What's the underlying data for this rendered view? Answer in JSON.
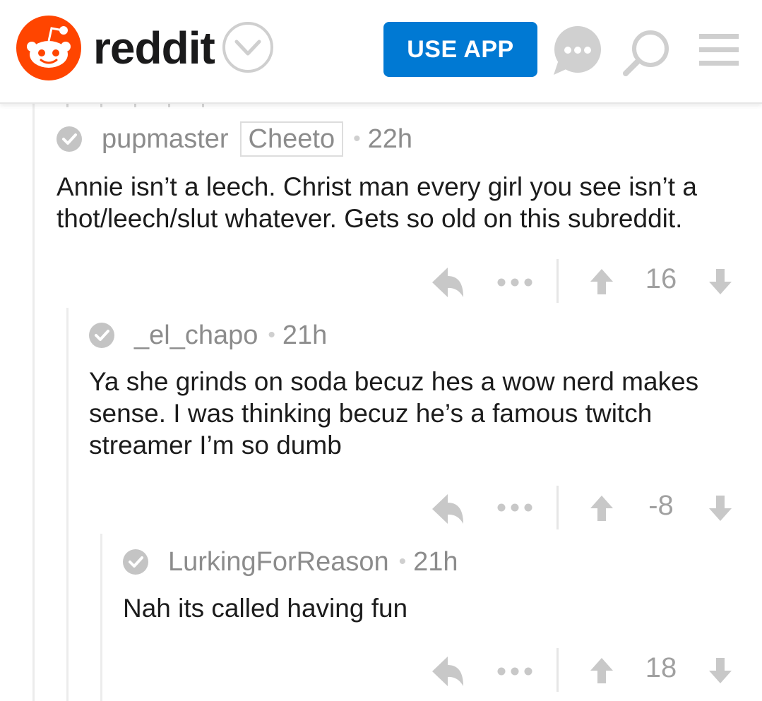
{
  "header": {
    "wordmark": "reddit",
    "use_app_label": "USE APP",
    "brand_color": "#ff4500",
    "accent_color": "#0079d3"
  },
  "comments": [
    {
      "author": "pupmaster",
      "flair": "Cheeto",
      "age": "22h",
      "body": "Annie isn’t a leech. Christ man every girl you see isn’t a thot/leech/slut whatever. Gets so old on this subreddit.",
      "score": "16"
    },
    {
      "author": "_el_chapo",
      "age": "21h",
      "body": "Ya she grinds on soda becuz hes a wow nerd makes sense. I was thinking becuz he’s a famous twitch streamer I’m so dumb",
      "score": "-8"
    },
    {
      "author": "LurkingForReason",
      "age": "21h",
      "body": "Nah its called having fun",
      "score": "18"
    }
  ],
  "icons": {
    "logo": "reddit-alien-icon",
    "chevron": "chevron-down-icon",
    "chat": "chat-icon",
    "search": "search-icon",
    "menu": "menu-icon",
    "verified": "check-circle-icon",
    "reply": "reply-icon",
    "more": "more-icon",
    "upvote": "upvote-icon",
    "downvote": "downvote-icon"
  }
}
